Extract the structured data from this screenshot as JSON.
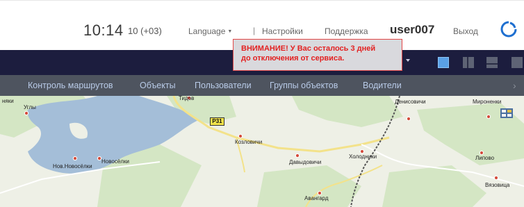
{
  "header": {
    "time": "10:14",
    "timezone": "10 (+03)",
    "language_label": "Language",
    "separator": "|",
    "settings_label": "Настройки",
    "support_label": "Поддержка",
    "username": "user007",
    "logout_label": "Выход"
  },
  "alert": {
    "line1": "ВНИМАНИЕ! У Вас осталось 3 дней",
    "line2": "до отключения от сервиса."
  },
  "nav": {
    "items": [
      {
        "label": "Контроль маршрутов"
      },
      {
        "label": "Объекты"
      },
      {
        "label": "Пользователи"
      },
      {
        "label": "Группы объектов"
      },
      {
        "label": "Водители"
      }
    ],
    "more_icon": "chevron-right-icon"
  },
  "map": {
    "road_label": "Р31",
    "places": [
      "Углы",
      "няки",
      "Тидов",
      "Козловичи",
      "Давыдовичи",
      "Холодники",
      "Денисовичи",
      "Мироненки",
      "Нов.Новосёлки",
      "Новосёлки",
      "Авангард",
      "Липово",
      "Вязовица"
    ]
  },
  "colors": {
    "toolbar": "#1c1d3e",
    "nav": "#4e545f",
    "nav_text": "#b9cbe8",
    "alert_text": "#e32121",
    "water": "#a4bed8"
  }
}
